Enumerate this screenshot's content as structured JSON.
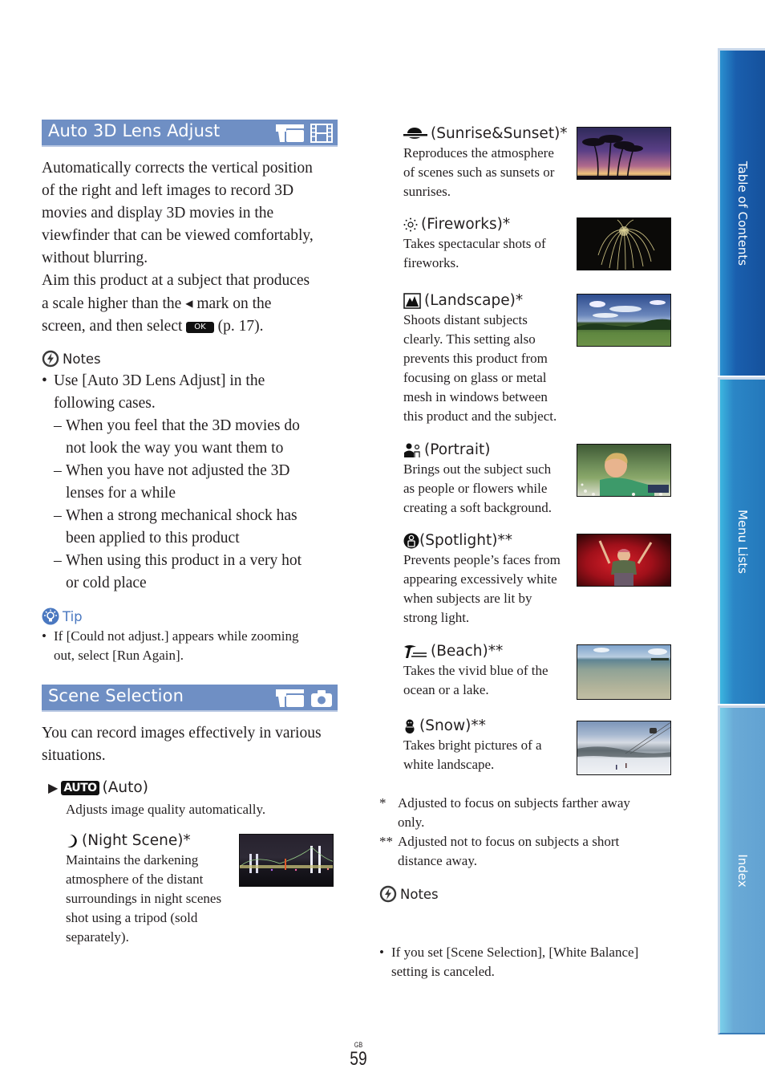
{
  "sections": {
    "lens_adjust": {
      "title": "Auto 3D Lens Adjust",
      "icons": [
        "camcorder-mode-icon",
        "movie-icon"
      ],
      "paragraph_lines": [
        "Automatically corrects the vertical position",
        "of the right and left images to record 3D",
        "movies and display 3D movies in the",
        "viewfinder that can be viewed comfortably,",
        "without blurring.",
        "Aim this product at a subject that produces",
        "a scale higher than the",
        "mark on the",
        "screen, and then select",
        "OK",
        "(p. 17)."
      ],
      "notes": {
        "heading": "Notes",
        "bullet_lines": [
          "Use [Auto 3D Lens Adjust] in the",
          "following cases."
        ],
        "dash_items": [
          [
            "When you feel that the 3D movies do",
            "not look the way you want them to"
          ],
          [
            "When you have not adjusted the 3D",
            "lenses for a while"
          ],
          [
            "When a strong mechanical shock has",
            "been applied to this product"
          ],
          [
            "When using this product in a very hot",
            "or cold place"
          ]
        ],
        "dash": "–"
      },
      "tip": {
        "heading": "Tip",
        "bullet_lines": [
          "If [Could not adjust.] appears while zooming",
          "out, select [Run Again]."
        ]
      }
    },
    "scene_selection": {
      "title": "Scene Selection",
      "icons": [
        "camcorder-mode-icon",
        "camera-icon"
      ],
      "intro_lines": [
        "You can record images effectively in various",
        "situations."
      ],
      "default_marker": "▶",
      "auto": {
        "badge": "AUTO",
        "label": "(Auto)",
        "desc": "Adjusts image quality automatically."
      },
      "scenes": [
        {
          "icon": "moon-icon",
          "label": "(Night Scene)*",
          "desc_lines": [
            "Maintains the darkening",
            "atmosphere of the distant",
            "surroundings in night scenes",
            "shot using a tripod (sold",
            "separately)."
          ],
          "image": "night-bridge-photo"
        },
        {
          "icon": "sunset-icon",
          "label": "(Sunrise&Sunset)*",
          "desc_lines": [
            "Reproduces the atmosphere",
            "of scenes such as sunsets or",
            "sunrises."
          ],
          "image": "palm-sunset-photo"
        },
        {
          "icon": "fireworks-icon",
          "label": "(Fireworks)*",
          "desc_lines": [
            "Takes spectacular shots of",
            "fireworks."
          ],
          "image": "fireworks-photo"
        },
        {
          "icon": "landscape-icon",
          "label": "(Landscape)*",
          "desc_lines": [
            "Shoots distant subjects",
            "clearly. This setting also",
            "prevents this product from",
            "focusing on glass or metal",
            "mesh in windows between",
            "this product and the subject."
          ],
          "image": "field-sky-photo"
        },
        {
          "icon": "portrait-icon",
          "label": "(Portrait)",
          "desc_lines": [
            "Brings out the subject such",
            "as people or flowers while",
            "creating a soft background."
          ],
          "image": "boy-grass-photo"
        },
        {
          "icon": "spotlight-icon",
          "label": "(Spotlight)**",
          "desc_lines": [
            "Prevents people’s faces from",
            "appearing excessively white",
            "when subjects are lit by",
            "strong light."
          ],
          "image": "girl-spotlight-photo"
        },
        {
          "icon": "beach-icon",
          "label": "(Beach)**",
          "desc_lines": [
            "Takes the vivid blue of the",
            "ocean or a lake."
          ],
          "image": "beach-water-photo"
        },
        {
          "icon": "snow-icon",
          "label": "(Snow)**",
          "desc_lines": [
            "Takes bright pictures of a",
            "white landscape."
          ],
          "image": "ski-slope-photo"
        }
      ],
      "footnotes": [
        {
          "mark": "*",
          "lines": [
            "Adjusted to focus on subjects farther away",
            "only."
          ]
        },
        {
          "mark": "**",
          "lines": [
            "Adjusted not to focus on subjects a short",
            "distance away."
          ]
        }
      ],
      "notes": {
        "heading": "Notes",
        "bullet_lines": [
          "If you set [Scene Selection], [White Balance]",
          "setting is canceled."
        ]
      }
    }
  },
  "side_tabs": [
    {
      "label": "Table of Contents",
      "color": "#1a5fae"
    },
    {
      "label": "Menu Lists",
      "color": "#2b86c6"
    },
    {
      "label": "Index",
      "color": "#6aaad6"
    }
  ],
  "footer": {
    "region": "GB",
    "page_number": "59"
  },
  "colors": {
    "heading_bar": "#6f8fc4",
    "tip_accent": "#4a78c0",
    "text": "#231f20"
  }
}
